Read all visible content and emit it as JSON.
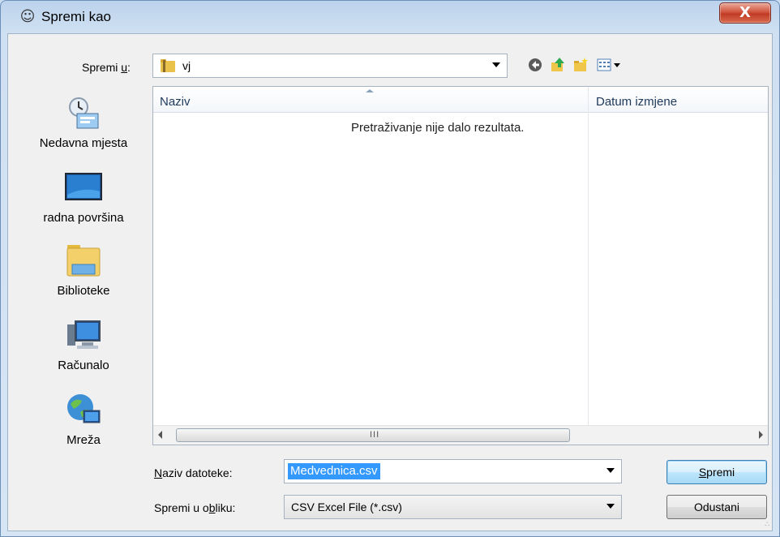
{
  "window": {
    "title": "Spremi kao",
    "close_label": "X"
  },
  "location": {
    "label_prefix": "Spremi ",
    "label_accel": "u",
    "label_suffix": ":",
    "folder": "vj"
  },
  "toolbar": {
    "icons": [
      "back-icon",
      "up-folder-icon",
      "new-folder-icon",
      "view-menu-icon"
    ]
  },
  "places": [
    {
      "label": "Nedavna mjesta",
      "icon": "recent-places-icon"
    },
    {
      "label": "radna površina",
      "icon": "desktop-icon"
    },
    {
      "label": "Biblioteke",
      "icon": "libraries-icon"
    },
    {
      "label": "Računalo",
      "icon": "computer-icon"
    },
    {
      "label": "Mreža",
      "icon": "network-icon"
    }
  ],
  "filelist": {
    "columns": [
      "Naziv",
      "Datum izmjene"
    ],
    "empty_message": "Pretraživanje nije dalo rezultata.",
    "scroll_grip": "III"
  },
  "filename": {
    "label_accel": "N",
    "label_rest": "aziv datoteke:",
    "value": "Medvednica.csv"
  },
  "filetype": {
    "label_prefix": "Spremi u o",
    "label_accel": "b",
    "label_suffix": "liku:",
    "value": "CSV Excel File (*.csv)"
  },
  "buttons": {
    "save_accel": "S",
    "save_rest": "premi",
    "cancel": "Odustani"
  },
  "colors": {
    "selection": "#3399ff",
    "close_button": "#c13b24"
  }
}
